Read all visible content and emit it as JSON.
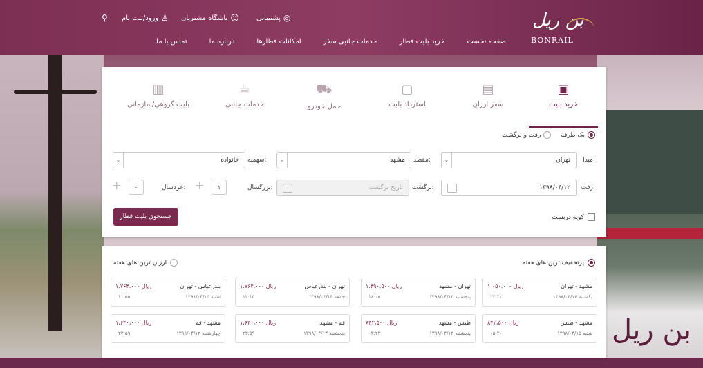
{
  "header": {
    "logo_text": "BONRAIL",
    "logo_mark": "بن ریل",
    "support": "پشتیبانی",
    "customer_club": "باشگاه مشتریان",
    "login": "ورود/ثبت نام",
    "nav": [
      "صفحه نخست",
      "خرید بلیت قطار",
      "خدمات جانبی سفر",
      "امکانات قطارها",
      "درباره ما",
      "تماس با ما"
    ]
  },
  "booking": {
    "tabs": [
      "خرید بلیت",
      "سفر ارزان",
      "استرداد بلیت",
      "حمل خودرو",
      "خدمات جانبی",
      "بلیت گروهی/سازمانی"
    ],
    "trip_types": [
      "یک طرفه",
      "رفت و برگشت"
    ],
    "origin_label": "مبدا:",
    "origin_value": "تهران",
    "destination_label": "مقصد:",
    "destination_value": "مشهد",
    "quota_label": "سهمیه:",
    "quota_value": "خانواده",
    "depart_label": "رفت:",
    "depart_value": "۱۳۹۸/۰۴/۱۲",
    "return_label": "برگشت:",
    "return_placeholder": "تاریخ برگشت",
    "adult_label": "بزرگسال:",
    "adult_value": "۱",
    "child_label": "خردسال:",
    "child_value": "۰",
    "coupe_label": "کوپه دربست",
    "search_button": "جستجوی بلیت قطار"
  },
  "offers": {
    "filter_discount": "پرتخفیف ترین های هفته",
    "filter_cheap": "ارزان ترین های هفته",
    "items": [
      {
        "route": "مشهد - تهران",
        "date": "یکشنبه ۱۳۹۸/۰۴/۱۶",
        "price": "۱،۰۵۰،۰۰۰ ریال",
        "time": "۲۲:۲۰"
      },
      {
        "route": "تهران - مشهد",
        "date": "پنجشنبه ۱۳۹۸/۰۴/۱۳",
        "price": "۱،۴۹۰،۵۰۰ ریال",
        "time": "۱۸:۰۵"
      },
      {
        "route": "تهران - بندرعباس",
        "date": "جمعه ۱۳۹۸/۰۴/۱۴",
        "price": "۱،۷۶۴،۰۰۰ ریال",
        "time": "۱۲:۱۵"
      },
      {
        "route": "بندرعباس - تهران",
        "date": "شنبه ۱۳۹۸/۰۴/۱۵",
        "price": "۱،۷۶۴،۰۰۰ ریال",
        "time": "۱۱:۵۵"
      },
      {
        "route": "مشهد - طبس",
        "date": "شنبه ۱۳۹۸/۰۴/۱۵",
        "price": "۸۴۲،۵۰۰ ریال",
        "time": "۱۵:۲۰"
      },
      {
        "route": "طبس - مشهد",
        "date": "پنجشنبه ۱۳۹۸/۰۴/۱۳",
        "price": "۸۴۲،۵۰۰ ریال",
        "time": "۰۳:۲۳"
      },
      {
        "route": "قم - مشهد",
        "date": "پنجشنبه ۱۳۹۸/۰۴/۱۳",
        "price": "۱،۶۴۰،۰۰۰ ریال",
        "time": "۲۳:۵۹"
      },
      {
        "route": "مشهد - قم",
        "date": "چهارشنبه ۱۳۹۸/۰۴/۱۲",
        "price": "۱،۶۴۰،۰۰۰ ریال",
        "time": "۲۳:۵۹"
      }
    ]
  },
  "colors": {
    "brand": "#7a2a4e",
    "header": "#8e3c62"
  }
}
